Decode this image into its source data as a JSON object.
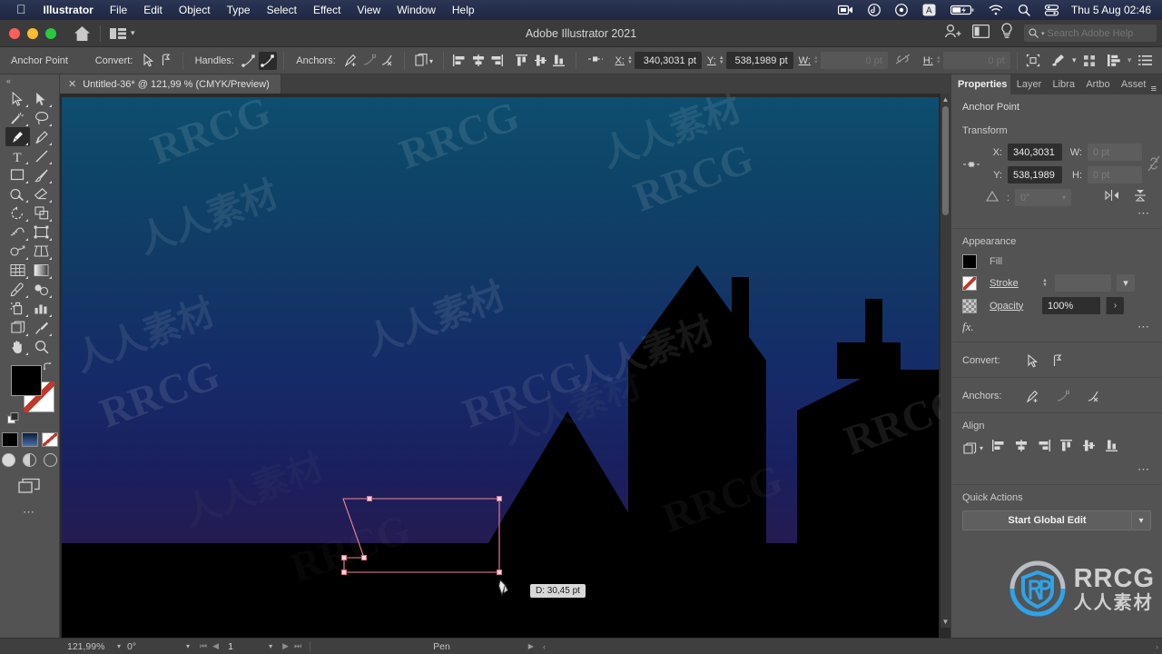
{
  "macbar": {
    "apple_icon": "apple-icon",
    "app_name": "Illustrator",
    "menus": [
      "File",
      "Edit",
      "Object",
      "Type",
      "Select",
      "Effect",
      "View",
      "Window",
      "Help"
    ],
    "status_icons": [
      "screen-record-icon",
      "bitwarden-icon",
      "play-circle-icon",
      "input-source-a-icon",
      "battery-charging-icon",
      "wifi-icon",
      "spotlight-search-icon",
      "control-center-icon"
    ],
    "clock": "Thu 5 Aug  02:46"
  },
  "titlebar": {
    "window_title": "Adobe Illustrator 2021",
    "home_icon": "home-icon",
    "workspace_icon": "workspace-switcher-icon",
    "workspace_chevron": "chevron-down-icon",
    "account_icon": "account-add-icon",
    "screenmode_icon": "screen-mode-icon",
    "discover_icon": "lightbulb-icon",
    "search_placeholder": "Search Adobe Help",
    "search_value": "",
    "search_icon": "search-icon"
  },
  "controlbar": {
    "selection_label": "Anchor Point",
    "convert_label": "Convert:",
    "convert_icons": [
      "convert-to-corner-icon",
      "convert-to-smooth-icon"
    ],
    "handles_label": "Handles:",
    "handles_icons": [
      "handle-extend-icon",
      "handle-retract-icon"
    ],
    "anchors_label": "Anchors:",
    "anchors_icons": [
      "add-anchor-icon",
      "remove-anchor-icon",
      "cut-path-icon"
    ],
    "isolate_icon": "isolate-selected-icon",
    "align_icons": [
      "align-left-icon",
      "align-center-h-icon",
      "align-right-icon",
      "align-top-icon",
      "align-center-v-icon",
      "align-bottom-icon"
    ],
    "reference_icon": "reference-point-icon",
    "x_label": "X:",
    "x_value": "340,3031 pt",
    "y_label": "Y:",
    "y_value": "538,1989 pt",
    "w_label": "W:",
    "w_value": "0 pt",
    "link_icon": "link-broken-icon",
    "h_label": "H:",
    "h_value": "0 pt",
    "transform_icon": "transform-icon",
    "shaper_icon": "shape-tool-icon",
    "shaper_chevron": "chevron-down-icon",
    "grid_icon": "grid-icon",
    "arrange_icon": "arrange-icon",
    "arrange_chevron": "chevron-down-icon",
    "options_icon": "panel-options-icon"
  },
  "document": {
    "tab_close_icon": "close-icon",
    "tab_title": "Untitled-36* @ 121,99 % (CMYK/Preview)"
  },
  "toolbar": {
    "collapse_icon": "collapse-panel-icon",
    "tools": [
      {
        "name": "selection-tool",
        "icon": "arrow-outline-icon",
        "selected": false
      },
      {
        "name": "direct-selection-tool",
        "icon": "arrow-solid-icon",
        "selected": false
      },
      {
        "name": "magic-wand-tool",
        "icon": "magic-wand-icon",
        "selected": false
      },
      {
        "name": "lasso-tool",
        "icon": "lasso-icon",
        "selected": false
      },
      {
        "name": "pen-tool",
        "icon": "pen-icon",
        "selected": true
      },
      {
        "name": "curvature-tool",
        "icon": "curvature-icon",
        "selected": false
      },
      {
        "name": "type-tool",
        "icon": "type-t-icon",
        "selected": false
      },
      {
        "name": "line-segment-tool",
        "icon": "line-icon",
        "selected": false
      },
      {
        "name": "rectangle-tool",
        "icon": "rectangle-icon",
        "selected": false
      },
      {
        "name": "paintbrush-tool",
        "icon": "paintbrush-icon",
        "selected": false
      },
      {
        "name": "shaper-tool",
        "icon": "shaper-icon",
        "selected": false
      },
      {
        "name": "eraser-tool",
        "icon": "eraser-icon",
        "selected": false
      },
      {
        "name": "rotate-tool",
        "icon": "rotate-icon",
        "selected": false
      },
      {
        "name": "scale-tool",
        "icon": "scale-icon",
        "selected": false
      },
      {
        "name": "width-tool",
        "icon": "width-icon",
        "selected": false
      },
      {
        "name": "free-transform-tool",
        "icon": "free-transform-icon",
        "selected": false
      },
      {
        "name": "shape-builder-tool",
        "icon": "shape-builder-icon",
        "selected": false
      },
      {
        "name": "perspective-grid-tool",
        "icon": "perspective-grid-icon",
        "selected": false
      },
      {
        "name": "mesh-tool",
        "icon": "mesh-icon",
        "selected": false
      },
      {
        "name": "gradient-tool",
        "icon": "gradient-icon",
        "selected": false
      },
      {
        "name": "eyedropper-tool",
        "icon": "eyedropper-icon",
        "selected": false
      },
      {
        "name": "blend-tool",
        "icon": "blend-icon",
        "selected": false
      },
      {
        "name": "symbol-sprayer-tool",
        "icon": "symbol-sprayer-icon",
        "selected": false
      },
      {
        "name": "column-graph-tool",
        "icon": "bar-chart-icon",
        "selected": false
      },
      {
        "name": "artboard-tool",
        "icon": "artboard-icon",
        "selected": false
      },
      {
        "name": "slice-tool",
        "icon": "slice-knife-icon",
        "selected": false
      },
      {
        "name": "hand-tool",
        "icon": "hand-icon",
        "selected": false
      },
      {
        "name": "zoom-tool",
        "icon": "magnifier-icon",
        "selected": false
      }
    ],
    "fill_color": "#000000",
    "stroke_color": "#ffffff",
    "stroke_is_none": true,
    "swap_icon": "swap-fill-stroke-icon",
    "default_icon": "default-fill-stroke-icon",
    "mini_swatches": [
      "color-black",
      "gradient-blue",
      "none"
    ],
    "draw_modes": [
      "draw-normal",
      "draw-behind",
      "draw-inside"
    ],
    "screen_mode_icon": "change-screen-mode-icon",
    "more_icon": "edit-toolbar-icon"
  },
  "properties": {
    "tabs": [
      "Properties",
      "Layer",
      "Libra",
      "Artbo",
      "Asset"
    ],
    "active_tab": "Properties",
    "menu_icon": "panel-menu-icon",
    "object_type": "Anchor Point",
    "transform": {
      "heading": "Transform",
      "reference_icon": "reference-point-icon",
      "x_label": "X:",
      "x_value": "340,3031",
      "y_label": "Y:",
      "y_value": "538,1989",
      "w_label": "W:",
      "w_value": "0 pt",
      "h_label": "H:",
      "h_value": "0 pt",
      "link_icon": "constrain-proportions-off-icon",
      "angle_label": "angle-icon",
      "angle_value": "0°",
      "flip_h_icon": "flip-horizontal-icon",
      "flip_v_icon": "flip-vertical-icon",
      "more_icon": "more-options-icon"
    },
    "appearance": {
      "heading": "Appearance",
      "fill_label": "Fill",
      "fill_color": "#000000",
      "stroke_label": "Stroke",
      "stroke_weight": "",
      "stroke_chevron": "chevron-down-icon",
      "opacity_label": "Opacity",
      "opacity_value": "100%",
      "opacity_arrow": "chevron-right-icon",
      "fx_label": "fx.",
      "more_icon": "more-options-icon"
    },
    "convert": {
      "label": "Convert:",
      "icons": [
        "convert-to-corner-icon",
        "convert-to-smooth-icon"
      ]
    },
    "anchors": {
      "label": "Anchors:",
      "icons": [
        "add-anchor-icon",
        "remove-anchor-icon",
        "cut-path-icon"
      ]
    },
    "align": {
      "heading": "Align",
      "target_icon": "align-to-artboard-icon",
      "target_chevron": "chevron-down-icon",
      "icons": [
        "align-left-icon",
        "align-center-h-icon",
        "align-right-icon",
        "align-top-icon",
        "align-center-v-icon",
        "align-bottom-icon"
      ],
      "more_icon": "more-options-icon"
    },
    "quick_actions": {
      "heading": "Quick Actions",
      "button_label": "Start Global Edit",
      "button_chevron": "chevron-down-icon"
    }
  },
  "canvas": {
    "tooltip_text": "D: 30,45 pt",
    "cursor_icon": "pen-cursor-icon",
    "path_stroke_color": "#f08898",
    "anchor_fill_color": "#ffd2dc",
    "sky_gradient_top": "#0e4e70",
    "sky_gradient_mid": "#152a68",
    "sky_gradient_bottom": "#2d1745",
    "ground_color": "#000000"
  },
  "statusbar": {
    "zoom_value": "121,99%",
    "zoom_chevron": "chevron-down-icon",
    "rotation_value": "0°",
    "rotation_chevron": "chevron-down-icon",
    "nav_first_icon": "first-artboard-icon",
    "nav_prev_icon": "previous-artboard-icon",
    "artboard_number": "1",
    "artboard_chevron": "chevron-down-icon",
    "nav_next_icon": "next-artboard-icon",
    "nav_last_icon": "last-artboard-icon",
    "current_tool": "Pen",
    "play_icon": "play-icon",
    "resize_icon": "resize-grip-icon"
  },
  "watermark": {
    "brand_latin": "RRCG",
    "brand_cjk": "人人素材",
    "logo_icon": "rrcg-shield-logo-icon",
    "tiles": [
      "RRCG",
      "人人素材"
    ]
  }
}
